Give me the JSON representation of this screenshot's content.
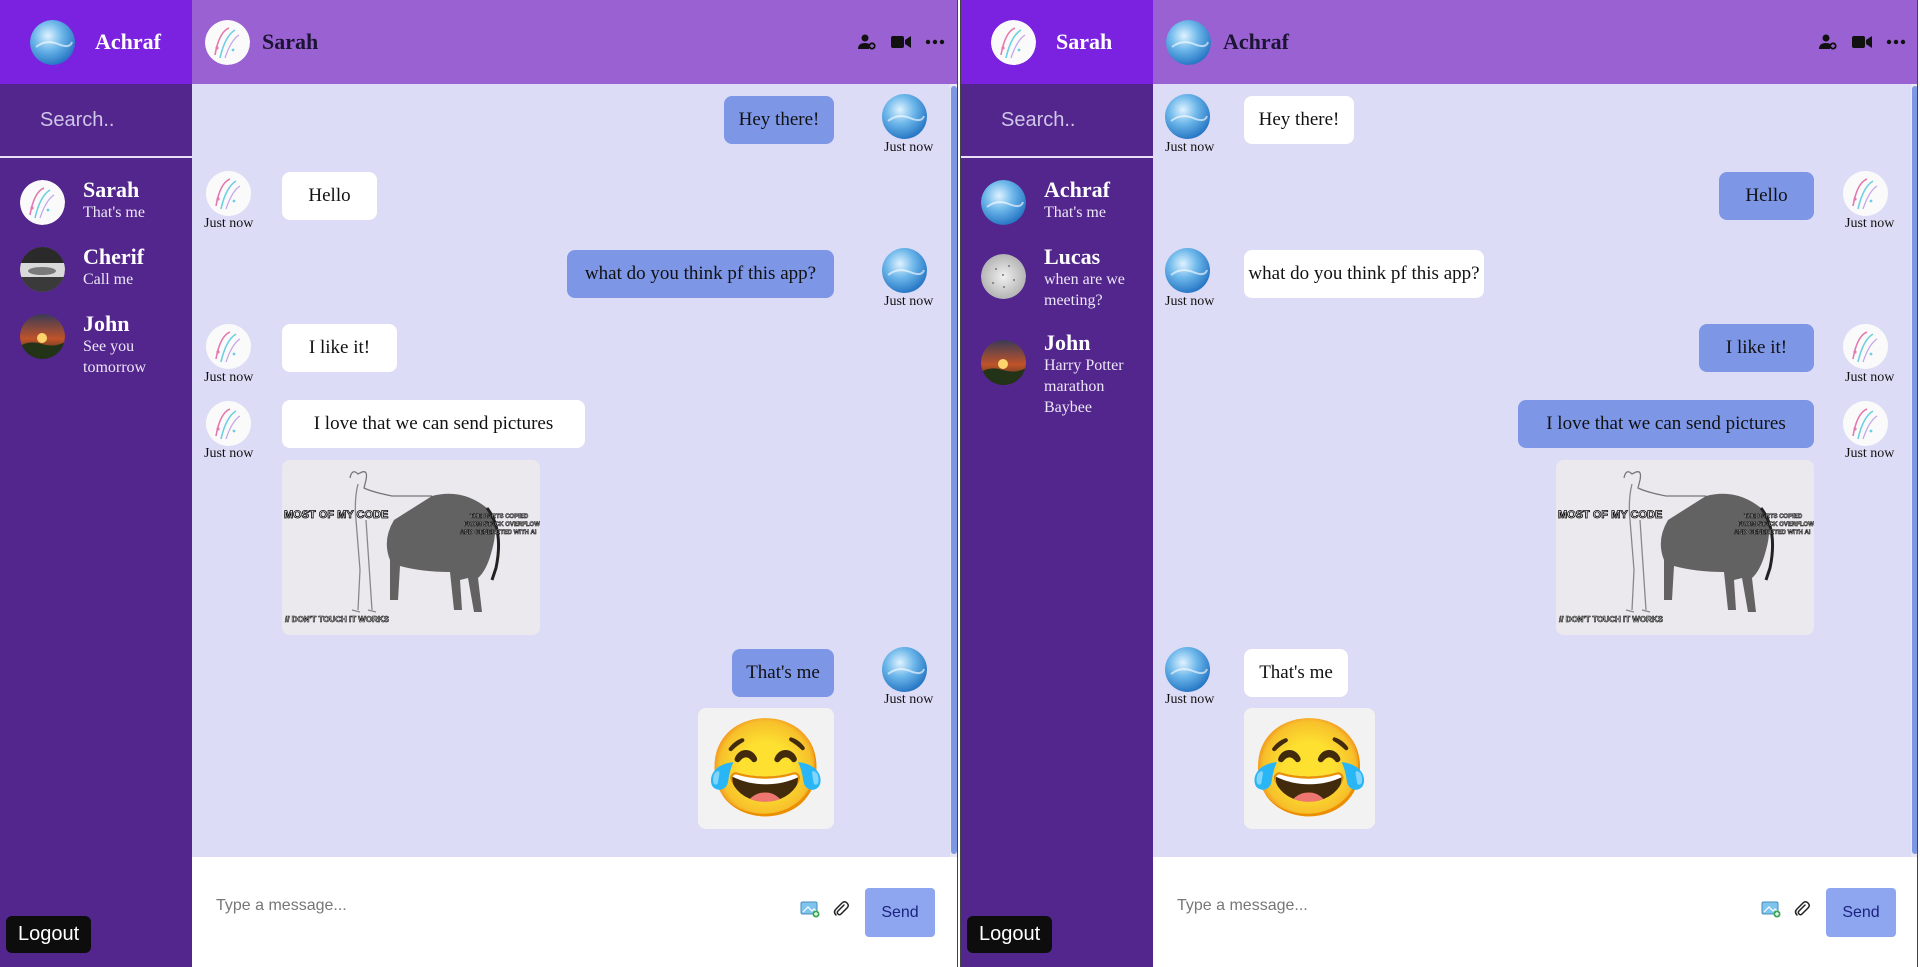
{
  "left": {
    "user_name": "Achraf",
    "search_placeholder": "Search..",
    "contacts": [
      {
        "name": "Sarah",
        "last": "That's me"
      },
      {
        "name": "Cherif",
        "last": "Call me"
      },
      {
        "name": "John",
        "last": "See you tomorrow"
      }
    ],
    "chat_name": "Sarah",
    "messages": [
      "Hey there!",
      "Hello",
      "what do you think pf this app?",
      "I like it!",
      "I love that we can send pictures",
      "That's me"
    ],
    "timestamp": "Just now",
    "logout": "Logout",
    "composer_placeholder": "Type a message...",
    "send": "Send"
  },
  "right": {
    "user_name": "Sarah",
    "search_placeholder": "Search..",
    "contacts": [
      {
        "name": "Achraf",
        "last": "That's me"
      },
      {
        "name": "Lucas",
        "last": "when are we meeting?"
      },
      {
        "name": "John",
        "last": "Harry Potter marathon Baybee"
      }
    ],
    "chat_name": "Achraf",
    "messages": [
      "Hey there!",
      "Hello",
      "what do you think pf this app?",
      "I like it!",
      "I love that we can send pictures",
      "That's me"
    ],
    "timestamp": "Just now",
    "logout": "Logout",
    "composer_placeholder": "Type a message...",
    "send": "Send"
  },
  "meme": {
    "left_text": "MOST OF MY CODE",
    "right_text": "THE PARTS COPIED FROM STACK OVERFLOW AND GENERETED WITH AI",
    "bottom_text": "// DON'T TOUCH IT WORKS"
  },
  "emoji": "😂",
  "icons": [
    "add-user-icon",
    "video-call-icon",
    "more-options-icon",
    "image-upload-icon",
    "paperclip-icon"
  ],
  "colors": {
    "sidebar": "#53268d",
    "sidebar_header": "#7a22e0",
    "chat_header": "#9a61d3",
    "chat_bg": "#dddcf6",
    "bubble_out": "#7d96e6",
    "bubble_in": "#ffffff",
    "send_button": "#8ea6ef"
  }
}
